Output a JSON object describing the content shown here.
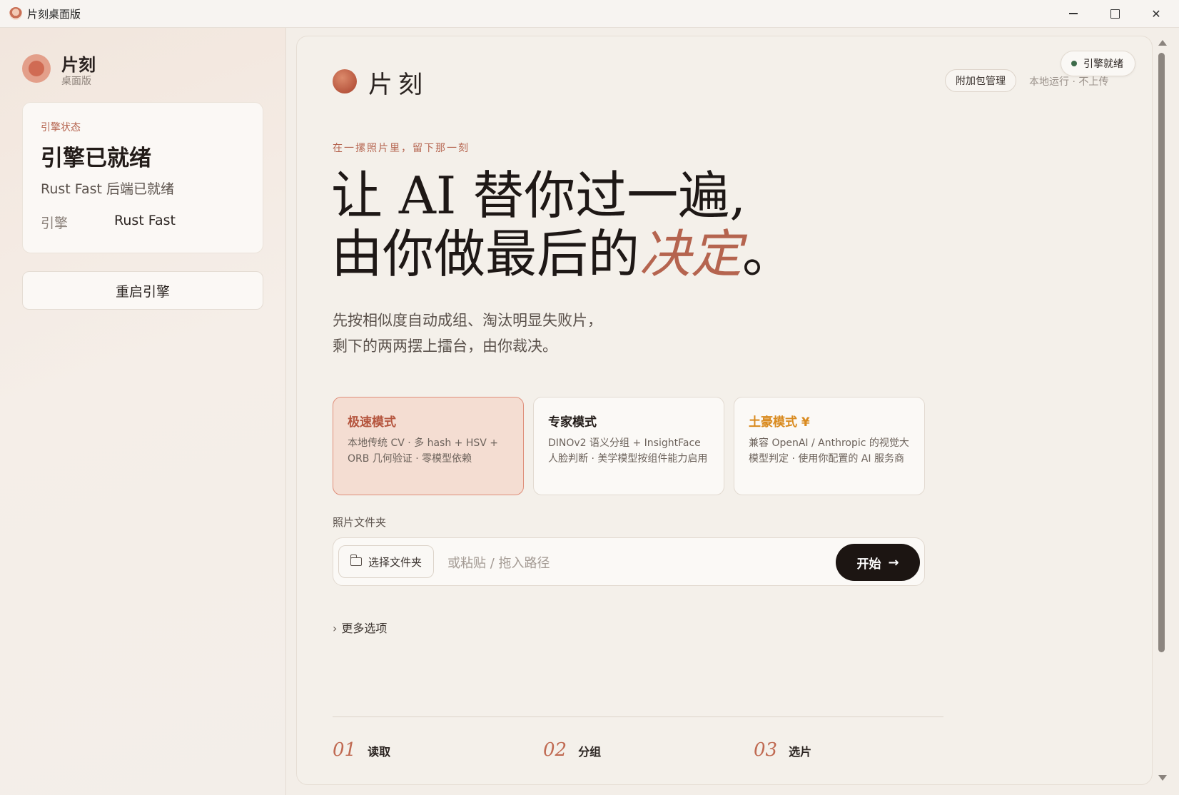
{
  "window": {
    "title": "片刻桌面版"
  },
  "sidebar": {
    "brand_name": "片刻",
    "brand_sub": "桌面版",
    "status_card": {
      "label": "引擎状态",
      "title": "引擎已就绪",
      "desc": "Rust Fast 后端已就绪",
      "engine_key": "引擎",
      "engine_value": "Rust Fast"
    },
    "restart_label": "重启引擎"
  },
  "header": {
    "title": "片刻",
    "addon_label": "附加包管理",
    "local_note": "本地运行 · 不上传",
    "engine_pill": "引擎就绪"
  },
  "hero": {
    "tagline": "在一摞照片里，留下那一刻",
    "line1": "让 AI 替你过一遍,",
    "line2_a": "由你做最后的",
    "line2_accent": "决定",
    "line2_b": "。",
    "sub1": "先按相似度自动成组、淘汰明显失败片，",
    "sub2": "剩下的两两摆上擂台，由你裁决。"
  },
  "modes": [
    {
      "title": "极速模式",
      "desc": "本地传统 CV · 多 hash + HSV + ORB 几何验证 · 零模型依赖"
    },
    {
      "title": "专家模式",
      "desc": "DINOv2 语义分组 + InsightFace 人脸判断 · 美学模型按组件能力启用"
    },
    {
      "title": "土豪模式 ¥",
      "desc": "兼容 OpenAI / Anthropic 的视觉大模型判定 · 使用你配置的 AI 服务商"
    }
  ],
  "folder": {
    "label": "照片文件夹",
    "choose_label": "选择文件夹",
    "placeholder": "或粘贴 / 拖入路径",
    "start_label": "开始"
  },
  "more_options": "更多选项",
  "steps": [
    {
      "num": "01",
      "label": "读取"
    },
    {
      "num": "02",
      "label": "分组"
    },
    {
      "num": "03",
      "label": "选片"
    }
  ],
  "colors": {
    "accent": "#b5644f",
    "dark": "#1c1512",
    "gold": "#d98a1e"
  }
}
